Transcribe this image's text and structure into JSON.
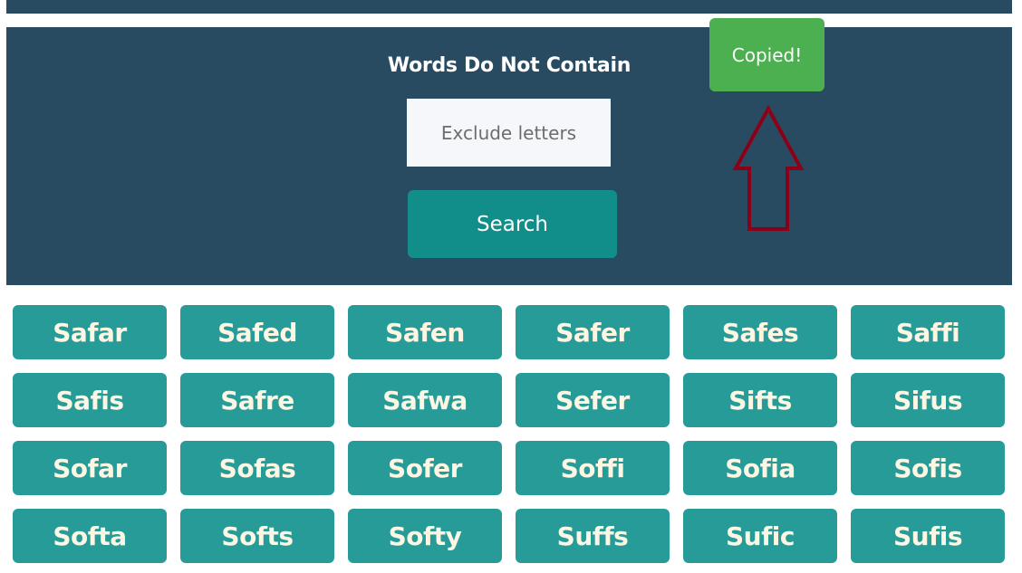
{
  "search_panel": {
    "title": "Words Do Not Contain",
    "exclude_input": {
      "value": "",
      "placeholder": "Exclude letters"
    },
    "search_label": "Search"
  },
  "toast": {
    "message": "Copied!"
  },
  "annotation": {
    "icon": "arrow-up-outline-icon",
    "color": "#8b0016"
  },
  "colors": {
    "panel_bg": "#284b61",
    "search_button": "#128e8a",
    "word_tile": "#279b98",
    "toast": "#4caf50"
  },
  "words": [
    "Safar",
    "Safed",
    "Safen",
    "Safer",
    "Safes",
    "Saffi",
    "Safis",
    "Safre",
    "Safwa",
    "Sefer",
    "Sifts",
    "Sifus",
    "Sofar",
    "Sofas",
    "Sofer",
    "Soffi",
    "Sofia",
    "Sofis",
    "Softa",
    "Softs",
    "Softy",
    "Suffs",
    "Sufic",
    "Sufis"
  ]
}
